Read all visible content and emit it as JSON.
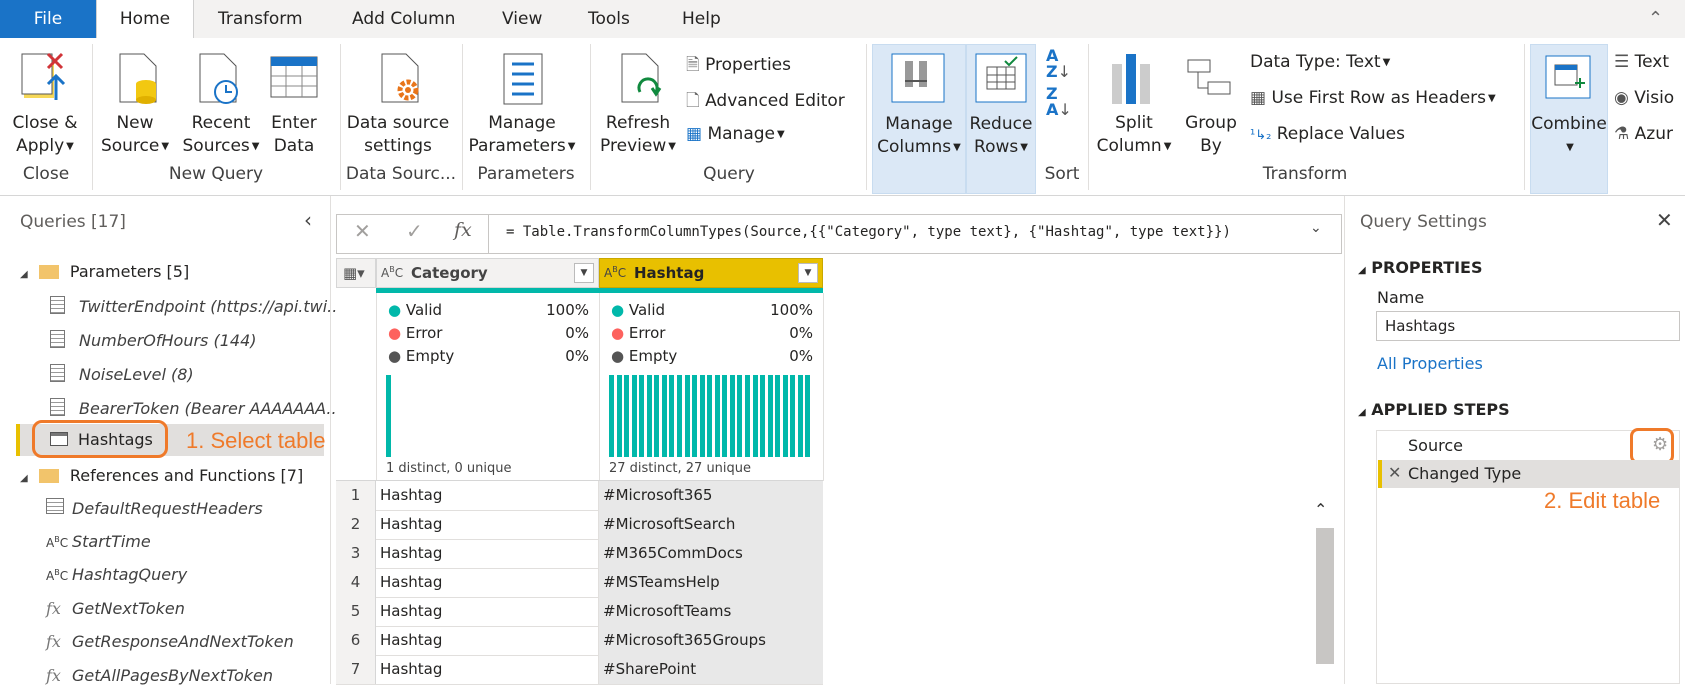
{
  "tabs": [
    "File",
    "Home",
    "Transform",
    "Add Column",
    "View",
    "Tools",
    "Help"
  ],
  "ribbon": {
    "close_apply": [
      "Close &",
      "Apply"
    ],
    "new_source": [
      "New",
      "Source"
    ],
    "recent_sources": [
      "Recent",
      "Sources"
    ],
    "enter_data": [
      "Enter",
      "Data"
    ],
    "data_source_settings": [
      "Data source",
      "settings"
    ],
    "manage_parameters": [
      "Manage",
      "Parameters"
    ],
    "refresh_preview": [
      "Refresh",
      "Preview"
    ],
    "properties": "Properties",
    "advanced_editor": "Advanced Editor",
    "manage": "Manage",
    "manage_columns": [
      "Manage",
      "Columns"
    ],
    "reduce_rows": [
      "Reduce",
      "Rows"
    ],
    "split_column": [
      "Split",
      "Column"
    ],
    "group_by": [
      "Group",
      "By"
    ],
    "data_type": "Data Type: Text",
    "use_first_row": "Use First Row as Headers",
    "replace_values": "Replace Values",
    "combine": "Combine",
    "text_analytics": "Text",
    "vision": "Visio",
    "azure_ml": "Azur",
    "groups": {
      "close": "Close",
      "new_query": "New Query",
      "data_sources": "Data Sourc...",
      "parameters": "Parameters",
      "query": "Query",
      "sort": "Sort",
      "transform": "Transform"
    }
  },
  "queries": {
    "header": "Queries [17]",
    "parameters_folder": "Parameters [5]",
    "params": [
      "TwitterEndpoint (https://api.twi...",
      "NumberOfHours (144)",
      "NoiseLevel (8)",
      "BearerToken (Bearer AAAAAAA..."
    ],
    "selected": "Hashtags",
    "annotation_select": "1. Select table",
    "refs_folder": "References and Functions [7]",
    "refs": [
      "DefaultRequestHeaders",
      "StartTime",
      "HashtagQuery",
      "GetNextToken",
      "GetResponseAndNextToken",
      "GetAllPagesByNextToken"
    ]
  },
  "formula": "= Table.TransformColumnTypes(Source,{{\"Category\", type text}, {\"Hashtag\", type text}})",
  "grid": {
    "columns": [
      {
        "name": "Category",
        "valid": "100%",
        "error": "0%",
        "empty": "0%",
        "distinct": "1 distinct, 0 unique"
      },
      {
        "name": "Hashtag",
        "valid": "100%",
        "error": "0%",
        "empty": "0%",
        "distinct": "27 distinct, 27 unique"
      }
    ],
    "quality_labels": [
      "Valid",
      "Error",
      "Empty"
    ],
    "rows": [
      [
        "1",
        "Hashtag",
        "#Microsoft365"
      ],
      [
        "2",
        "Hashtag",
        "#MicrosoftSearch"
      ],
      [
        "3",
        "Hashtag",
        "#M365CommDocs"
      ],
      [
        "4",
        "Hashtag",
        "#MSTeamsHelp"
      ],
      [
        "5",
        "Hashtag",
        "#MicrosoftTeams"
      ],
      [
        "6",
        "Hashtag",
        "#Microsoft365Groups"
      ],
      [
        "7",
        "Hashtag",
        "#SharePoint"
      ]
    ]
  },
  "settings": {
    "title": "Query Settings",
    "properties": "PROPERTIES",
    "name_label": "Name",
    "name_value": "Hashtags",
    "all_properties": "All Properties",
    "applied_steps": "APPLIED STEPS",
    "steps": [
      "Source",
      "Changed Type"
    ],
    "annotation_edit": "2. Edit table"
  },
  "colors": {
    "accent": "#1a73c7",
    "highlight": "#ef7a2a",
    "teal": "#01b8aa",
    "selected_col": "#e8c000"
  }
}
